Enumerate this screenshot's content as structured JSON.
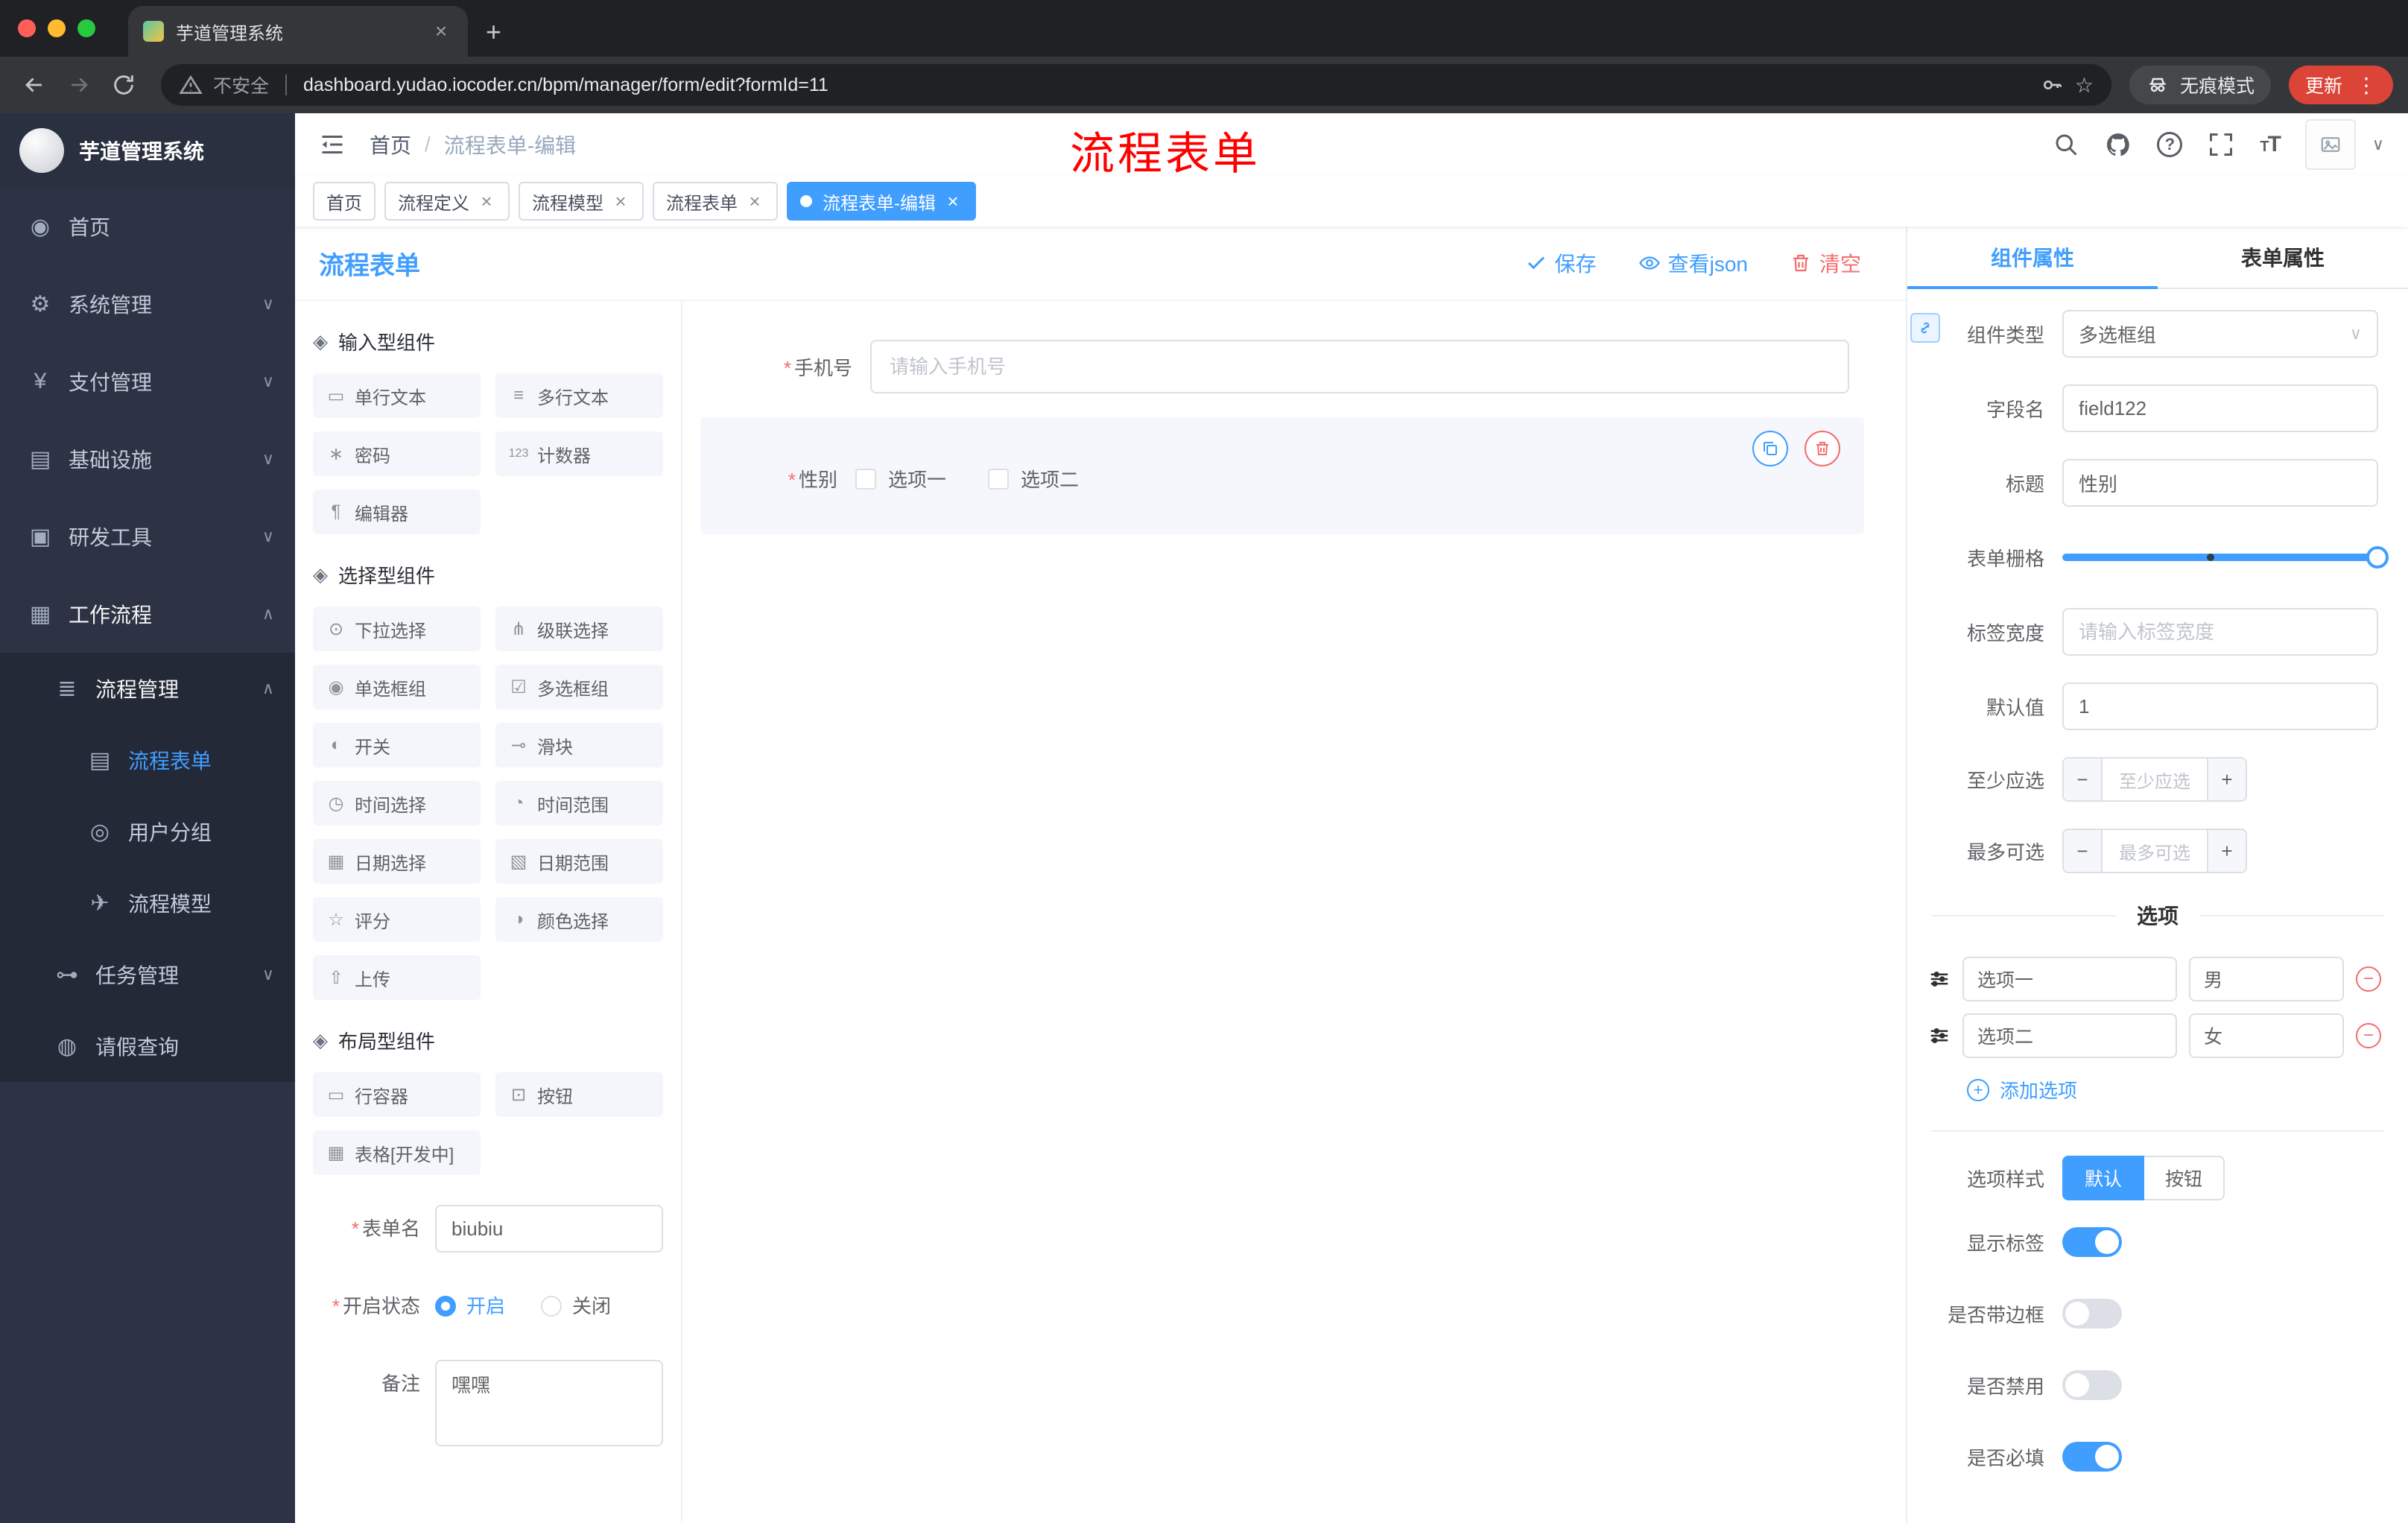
{
  "browser": {
    "tab_title": "芋道管理系统",
    "security_label": "不安全",
    "url": "dashboard.yudao.iocoder.cn/bpm/manager/form/edit?formId=11",
    "incognito_label": "无痕模式",
    "update_label": "更新"
  },
  "annotation": {
    "text": "流程表单",
    "color": "#ff0000"
  },
  "icons": {
    "close": "×",
    "plus": "+",
    "minus": "−",
    "star": "☆",
    "kebab": "⋮",
    "caret_down": "∨",
    "chev_up": "∧",
    "chev_down": "∨",
    "question": "?",
    "required": "*",
    "font_size": "TT",
    "slash": "/"
  },
  "sidebar": {
    "logo_title": "芋道管理系统",
    "items": [
      {
        "label": "首页",
        "icon": "◉"
      },
      {
        "label": "系统管理",
        "icon": "⚙"
      },
      {
        "label": "支付管理",
        "icon": "¥"
      },
      {
        "label": "基础设施",
        "icon": "▤"
      },
      {
        "label": "研发工具",
        "icon": "▣"
      },
      {
        "label": "工作流程",
        "icon": "▦"
      },
      {
        "label": "流程管理",
        "icon": "≣"
      },
      {
        "label": "流程表单",
        "icon": "▤"
      },
      {
        "label": "用户分组",
        "icon": "◎"
      },
      {
        "label": "流程模型",
        "icon": "✈"
      },
      {
        "label": "任务管理",
        "icon": "⊶"
      },
      {
        "label": "请假查询",
        "icon": "◍"
      }
    ]
  },
  "header": {
    "breadcrumb": {
      "home": "首页",
      "current": "流程表单-编辑"
    }
  },
  "tags": [
    {
      "label": "首页"
    },
    {
      "label": "流程定义"
    },
    {
      "label": "流程模型"
    },
    {
      "label": "流程表单"
    },
    {
      "label": "流程表单-编辑"
    }
  ],
  "designer": {
    "title": "流程表单",
    "save_label": "保存",
    "view_json_label": "查看json",
    "clear_label": "清空",
    "groups": [
      {
        "title": "输入型组件",
        "icon": "◈",
        "items": [
          {
            "label": "单行文本",
            "icon": "▭"
          },
          {
            "label": "多行文本",
            "icon": "≡"
          },
          {
            "label": "密码",
            "icon": "∗"
          },
          {
            "label": "计数器",
            "icon": "123"
          },
          {
            "label": "编辑器",
            "icon": "¶"
          }
        ]
      },
      {
        "title": "选择型组件",
        "icon": "◈",
        "items": [
          {
            "label": "下拉选择",
            "icon": "⊙"
          },
          {
            "label": "级联选择",
            "icon": "⋔"
          },
          {
            "label": "单选框组",
            "icon": "◉"
          },
          {
            "label": "多选框组",
            "icon": "☑"
          },
          {
            "label": "开关",
            "icon": "◐"
          },
          {
            "label": "滑块",
            "icon": "⊸"
          },
          {
            "label": "时间选择",
            "icon": "◷"
          },
          {
            "label": "时间范围",
            "icon": "◔"
          },
          {
            "label": "日期选择",
            "icon": "▦"
          },
          {
            "label": "日期范围",
            "icon": "▧"
          },
          {
            "label": "评分",
            "icon": "☆"
          },
          {
            "label": "颜色选择",
            "icon": "◑"
          },
          {
            "label": "上传",
            "icon": "⇧"
          }
        ]
      },
      {
        "title": "布局型组件",
        "icon": "◈",
        "items": [
          {
            "label": "行容器",
            "icon": "▭"
          },
          {
            "label": "按钮",
            "icon": "⊡"
          },
          {
            "label": "表格[开发中]",
            "icon": "▦"
          }
        ]
      }
    ],
    "meta": {
      "form_name_label": "表单名",
      "form_name_value": "biubiu",
      "status_label": "开启状态",
      "status_on": "开启",
      "status_off": "关闭",
      "remark_label": "备注",
      "remark_value": "嘿嘿"
    },
    "canvas": {
      "phone_label": "手机号",
      "phone_placeholder": "请输入手机号",
      "gender_label": "性别",
      "gender_options": [
        {
          "label": "选项一"
        },
        {
          "label": "选项二"
        }
      ]
    }
  },
  "props": {
    "tab_component": "组件属性",
    "tab_form": "表单属性",
    "rows": {
      "component_type_label": "组件类型",
      "component_type_value": "多选框组",
      "field_name_label": "字段名",
      "field_name_value": "field122",
      "title_label": "标题",
      "title_value": "性别",
      "grid_label": "表单栅格",
      "label_width_label": "标签宽度",
      "label_width_placeholder": "请输入标签宽度",
      "default_label": "默认值",
      "default_value": "1",
      "min_label": "至少应选",
      "min_placeholder": "至少应选",
      "max_label": "最多可选",
      "max_placeholder": "最多可选"
    },
    "options": {
      "divider": "选项",
      "rows": [
        {
          "label": "选项一",
          "value": "男"
        },
        {
          "label": "选项二",
          "value": "女"
        }
      ],
      "add_label": "添加选项"
    },
    "style": {
      "option_style_label": "选项样式",
      "style_default": "默认",
      "style_button": "按钮",
      "toggles": [
        {
          "label": "显示标签",
          "on": true
        },
        {
          "label": "是否带边框",
          "on": false
        },
        {
          "label": "是否禁用",
          "on": false
        },
        {
          "label": "是否必填",
          "on": true
        }
      ]
    }
  },
  "colors": {
    "accent": "#409eff",
    "danger": "#f56c6c",
    "annotation": "#ff0000"
  }
}
